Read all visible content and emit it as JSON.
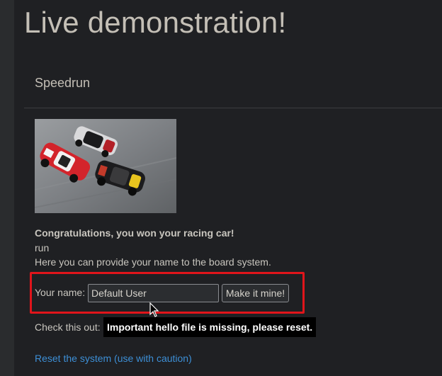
{
  "header": {
    "title": "Live demonstration!"
  },
  "section": {
    "title": "Speedrun"
  },
  "image": {
    "subject": "racing cars on track"
  },
  "content": {
    "congrats": "Congratulations, you won your racing car!",
    "run": "run",
    "instruction": "Here you can provide your name to the board system."
  },
  "form": {
    "label": "Your name:",
    "input_value": "Default User",
    "button_label": "Make it mine!"
  },
  "check": {
    "label": "Check this out:",
    "tooltip": "Important hello file is missing, please reset."
  },
  "links": {
    "reset": "Reset the system (use with caution)"
  },
  "colors": {
    "background": "#1f2023",
    "highlight": "#e0151b",
    "link": "#3d8fd6"
  }
}
